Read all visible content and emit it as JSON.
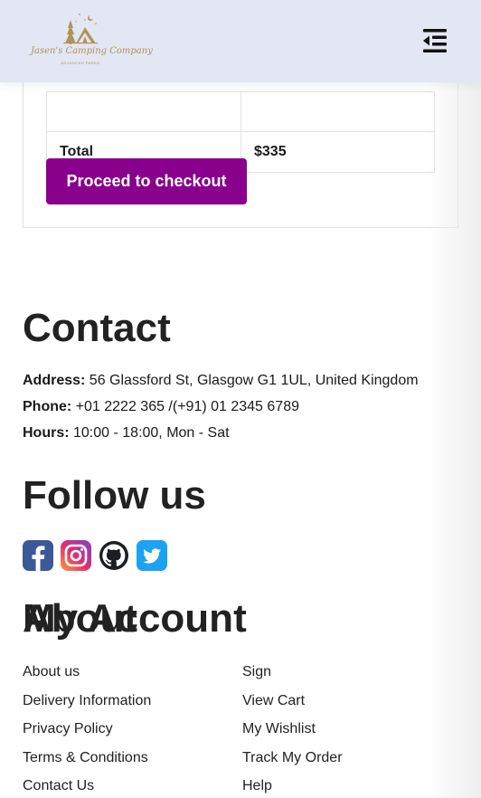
{
  "header": {
    "logo_text": "Jasen's Camping Company",
    "logo_sub": "ADVANCED PARKS",
    "brand_color": "#b0935a",
    "background": "#e3e6f3",
    "menu_icon": "menu-collapse-icon"
  },
  "cart": {
    "total_label": "Total",
    "total_value": "$335",
    "checkout_label": "Proceed to checkout",
    "checkout_color": "#88008c"
  },
  "contact": {
    "title": "Contact",
    "address_label": "Address:",
    "address_value": " 56 Glassford St, Glasgow G1 1UL, United Kingdom",
    "phone_label": "Phone:",
    "phone_value": " +01 2222 365 /(+91) 01 2345 6789",
    "hours_label": "Hours:",
    "hours_value": " 10:00 - 18:00, Mon - Sat"
  },
  "follow": {
    "title": "Follow us",
    "icons": [
      "facebook-icon",
      "instagram-icon",
      "github-icon",
      "twitter-icon"
    ]
  },
  "about": {
    "title": "About",
    "links": [
      "About us",
      "Delivery Information",
      "Privacy Policy",
      "Terms & Conditions",
      "Contact Us"
    ]
  },
  "account": {
    "title": "My Account",
    "links": [
      "Sign",
      "View Cart",
      "My Wishlist",
      "Track My Order",
      "Help"
    ]
  }
}
